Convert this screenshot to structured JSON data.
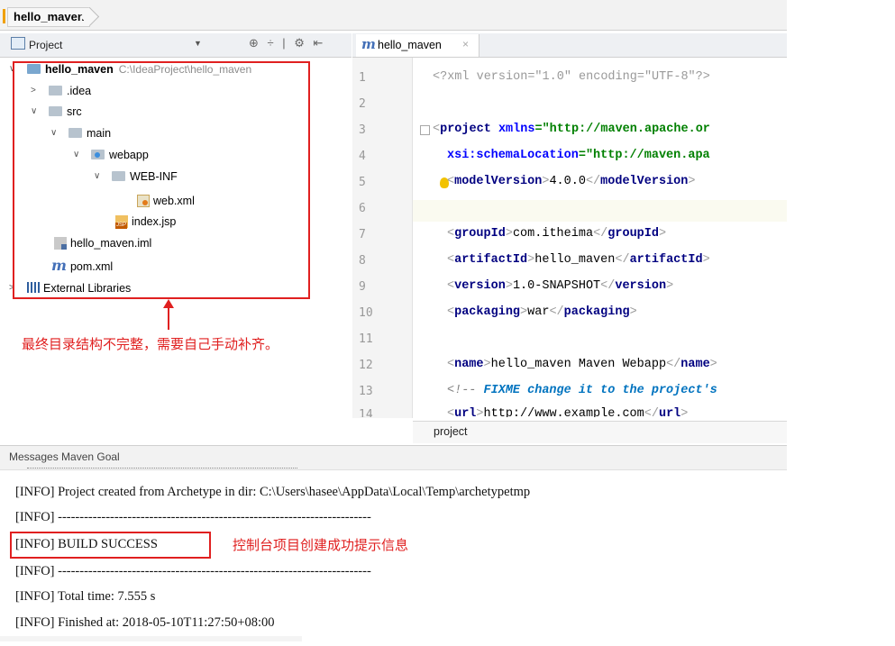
{
  "breadcrumb": {
    "project": "hello_maven"
  },
  "project_panel": {
    "title": "Project",
    "tree": [
      {
        "label": "hello_maven",
        "path": "C:\\IdeaProject\\hello_maven"
      },
      {
        "label": ".idea"
      },
      {
        "label": "src"
      },
      {
        "label": "main"
      },
      {
        "label": "webapp"
      },
      {
        "label": "WEB-INF"
      },
      {
        "label": "web.xml"
      },
      {
        "label": "index.jsp"
      },
      {
        "label": "hello_maven.iml"
      },
      {
        "label": "pom.xml"
      },
      {
        "label": "External Libraries"
      }
    ]
  },
  "annotation_tree": "最终目录结构不完整，需要自己手动补齐。",
  "editor": {
    "tab_label": "hello_maven",
    "line_numbers": [
      "1",
      "2",
      "3",
      "4",
      "5",
      "6",
      "7",
      "8",
      "9",
      "10",
      "11",
      "12",
      "13",
      "14"
    ],
    "breadcrumb": "project",
    "code": {
      "l1": "<?xml version=\"1.0\" encoding=\"UTF-8\"?>",
      "l3_tag": "project",
      "l3_attr": "xmlns",
      "l3_val": "\"http://maven.apache.or",
      "l4_attr": "xsi:schemaLocation",
      "l4_val": "\"http://maven.apa",
      "l5_tag": "modelVersion",
      "l5_val": "4.0.0",
      "l7_tag": "groupId",
      "l7_val": "com.itheima",
      "l8_tag": "artifactId",
      "l8_val": "hello_maven",
      "l9_tag": "version",
      "l9_val": "1.0-SNAPSHOT",
      "l10_tag": "packaging",
      "l10_val": "war",
      "l12_tag": "name",
      "l12_val": "hello_maven Maven Webapp",
      "l13_prefix": "<!-- ",
      "l13_fix": "FIXME change it to the project's",
      "l14_tag": "url",
      "l14_val": "http://www.example.com"
    }
  },
  "messages": {
    "title": "Messages Maven Goal",
    "lines": [
      "[INFO] Project created from Archetype in dir: C:\\Users\\hasee\\AppData\\Local\\Temp\\archetypetmp",
      "[INFO] ------------------------------------------------------------------------",
      "[INFO] BUILD SUCCESS",
      "[INFO] ------------------------------------------------------------------------",
      "[INFO] Total time: 7.555 s",
      "[INFO] Finished at: 2018-05-10T11:27:50+08:00"
    ],
    "annotation": "控制台项目创建成功提示信息"
  }
}
